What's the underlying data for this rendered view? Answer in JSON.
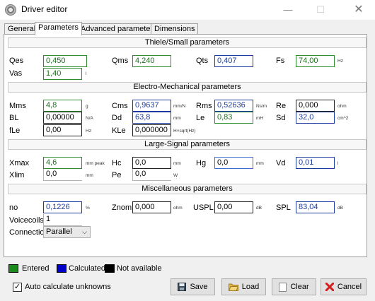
{
  "window": {
    "title": "Driver editor",
    "minimize": "—",
    "maximize": "☐",
    "close": "✕"
  },
  "tabs": [
    "General",
    "Parameters",
    "Advanced parameters",
    "Dimensions"
  ],
  "sections": {
    "ts": "Thiele/Small parameters",
    "em": "Electro-Mechanical parameters",
    "ls": "Large-Signal parameters",
    "misc": "Miscellaneous parameters"
  },
  "ts": {
    "qes": {
      "label": "Qes",
      "value": "0,450"
    },
    "qms": {
      "label": "Qms",
      "value": "4,240"
    },
    "qts": {
      "label": "Qts",
      "value": "0,407"
    },
    "fs": {
      "label": "Fs",
      "value": "74,00",
      "unit": "Hz"
    },
    "vas": {
      "label": "Vas",
      "value": "1,40",
      "unit": "l"
    }
  },
  "em": {
    "mms": {
      "label": "Mms",
      "value": "4,8",
      "unit": "g"
    },
    "cms": {
      "label": "Cms",
      "value": "0,9637",
      "unit": "mm/N"
    },
    "rms": {
      "label": "Rms",
      "value": "0,52636",
      "unit": "Ns/m"
    },
    "re": {
      "label": "Re",
      "value": "0,000",
      "unit": "ohm"
    },
    "bl": {
      "label": "BL",
      "value": "0,00000",
      "unit": "N/A"
    },
    "dd": {
      "label": "Dd",
      "value": "63,8",
      "unit": "mm"
    },
    "le": {
      "label": "Le",
      "value": "0,83",
      "unit": "mH"
    },
    "sd": {
      "label": "Sd",
      "value": "32,0",
      "unit": "cm^2"
    },
    "fle": {
      "label": "fLe",
      "value": "0,00",
      "unit": "Hz"
    },
    "kle": {
      "label": "KLe",
      "value": "0,000000",
      "unit": "H×sqrt(Hz)"
    }
  },
  "ls": {
    "xmax": {
      "label": "Xmax",
      "value": "4,6",
      "unit": "mm peak"
    },
    "hc": {
      "label": "Hc",
      "value": "0,0",
      "unit": "mm"
    },
    "hg": {
      "label": "Hg",
      "value": "0,0",
      "unit": "mm"
    },
    "vd": {
      "label": "Vd",
      "value": "0,01",
      "unit": "l"
    },
    "xlim": {
      "label": "Xlim",
      "value": "0,0",
      "unit": "mm"
    },
    "pe": {
      "label": "Pe",
      "value": "0,0",
      "unit": "W"
    }
  },
  "misc": {
    "no": {
      "label": "no",
      "value": "0,1226",
      "unit": "%"
    },
    "znom": {
      "label": "Znom",
      "value": "0,000",
      "unit": "ohm"
    },
    "uspl": {
      "label": "USPL",
      "value": "0,00",
      "unit": "dB"
    },
    "spl": {
      "label": "SPL",
      "value": "83,04",
      "unit": "dB"
    },
    "voicecoils": {
      "label": "Voicecoils",
      "value": "1"
    },
    "connection": {
      "label": "Connection",
      "value": "Parallel"
    }
  },
  "legend": {
    "entered": {
      "label": "Entered",
      "color": "#1a8a1a"
    },
    "calculated": {
      "label": "Calculated",
      "color": "#0000c8"
    },
    "na": {
      "label": "Not available",
      "color": "#000000"
    }
  },
  "auto_calc": {
    "label": "Auto calculate unknowns",
    "checked": true,
    "mark": "✓"
  },
  "buttons": {
    "save": "Save",
    "load": "Load",
    "clear": "Clear",
    "cancel": "Cancel"
  }
}
